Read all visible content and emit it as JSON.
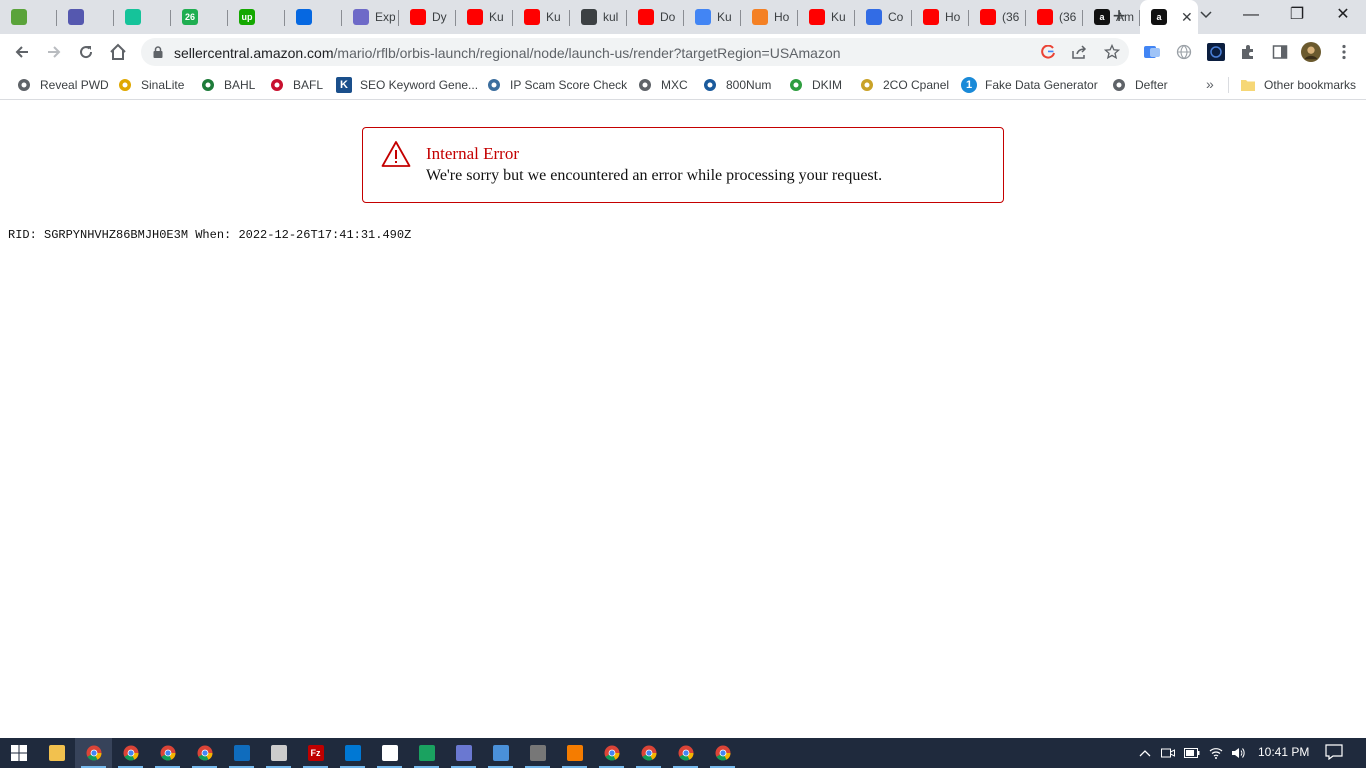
{
  "browser": {
    "tabs": [
      {
        "title": "",
        "icon": "script-icon",
        "color": "#5aa33a"
      },
      {
        "title": "",
        "icon": "teams-icon",
        "color": "#5558af"
      },
      {
        "title": "",
        "icon": "grammarly-icon",
        "color": "#15c39a"
      },
      {
        "title": "",
        "icon": "badge-26-icon",
        "color": "#1fae51",
        "badge": "26"
      },
      {
        "title": "",
        "icon": "upwork-icon",
        "color": "#14a800",
        "badge": "up"
      },
      {
        "title": "",
        "icon": "meta-icon",
        "color": "#0668e1"
      },
      {
        "title": "Exp",
        "icon": "explore-icon",
        "color": "#6e6ac8"
      },
      {
        "title": "Dy",
        "icon": "youtube-icon",
        "color": "#ff0000"
      },
      {
        "title": "Ku",
        "icon": "youtube-icon",
        "color": "#ff0000"
      },
      {
        "title": "Ku",
        "icon": "youtube-icon",
        "color": "#ff0000"
      },
      {
        "title": "kul",
        "icon": "kube-icon",
        "color": "#3c4043"
      },
      {
        "title": "Do",
        "icon": "youtube-icon",
        "color": "#ff0000"
      },
      {
        "title": "Ku",
        "icon": "google-cloud-icon",
        "color": "#4285f4"
      },
      {
        "title": "Ho",
        "icon": "stackoverflow-icon",
        "color": "#f48024"
      },
      {
        "title": "Ku",
        "icon": "youtube-icon",
        "color": "#ff0000"
      },
      {
        "title": "Co",
        "icon": "kubernetes-icon",
        "color": "#326ce5"
      },
      {
        "title": "Ho",
        "icon": "youtube-icon",
        "color": "#ff0000"
      },
      {
        "title": "(36",
        "icon": "youtube-icon",
        "color": "#ff0000"
      },
      {
        "title": "(36",
        "icon": "youtube-icon",
        "color": "#ff0000"
      },
      {
        "title": "Am",
        "icon": "amazon-icon",
        "color": "#111111",
        "badge": "a"
      }
    ],
    "active_tab": {
      "icon": "amazon-icon",
      "color": "#111111",
      "badge": "a",
      "close": "✕"
    },
    "new_tab": "+",
    "url_host": "sellercentral.amazon.com",
    "url_path": "/mario/rflb/orbis-launch/regional/node/launch-us/render?targetRegion=USAmazon",
    "window_controls": {
      "minimize": "—",
      "restore": "❐",
      "close": "✕"
    }
  },
  "bookmarks": [
    {
      "label": "Reveal PWD",
      "icon": "globe-icon",
      "color": "#5f6368"
    },
    {
      "label": "SinaLite",
      "icon": "dots-icon",
      "color": "#e0a800"
    },
    {
      "label": "BAHL",
      "icon": "bank-icon",
      "color": "#1e7b3a"
    },
    {
      "label": "BAFL",
      "icon": "alfalah-icon",
      "color": "#c8102e"
    },
    {
      "label": "SEO Keyword Gene...",
      "icon": "k-icon",
      "color": "#1a4f8b",
      "badge": "K"
    },
    {
      "label": "IP Scam Score Check",
      "icon": "shield-icon",
      "color": "#3c6e9e"
    },
    {
      "label": "MXC",
      "icon": "globe-icon",
      "color": "#5f6368"
    },
    {
      "label": "800Num",
      "icon": "grid-icon",
      "color": "#1a5a9c"
    },
    {
      "label": "DKIM",
      "icon": "wifi-icon",
      "color": "#2e9e3f"
    },
    {
      "label": "2CO Cpanel",
      "icon": "lock-icon",
      "color": "#c9a227"
    },
    {
      "label": "Fake Data Generator",
      "icon": "one-icon",
      "color": "#1a8ad8",
      "badge": "1"
    },
    {
      "label": "Defter",
      "icon": "globe-icon",
      "color": "#5f6368"
    }
  ],
  "bookmarks_more": "»",
  "other_bookmarks": "Other bookmarks",
  "error": {
    "title": "Internal Error",
    "message": "We're sorry but we encountered an error while processing your request."
  },
  "rid_line": "RID: SGRPYNHVHZ86BMJH0E3M When: 2022-12-26T17:41:31.490Z",
  "taskbar": {
    "apps": [
      {
        "icon": "windows-start-icon",
        "color": "#ffffff"
      },
      {
        "icon": "file-explorer-icon",
        "color": "#f2c14e"
      },
      {
        "icon": "chrome-icon",
        "color": "#4285f4",
        "active": true
      },
      {
        "icon": "chrome-icon",
        "color": "#4285f4"
      },
      {
        "icon": "chrome-icon",
        "color": "#4285f4"
      },
      {
        "icon": "chrome-icon",
        "color": "#4285f4"
      },
      {
        "icon": "mail-icon",
        "color": "#0f6cbd"
      },
      {
        "icon": "tools-icon",
        "color": "#cccccc"
      },
      {
        "icon": "filezilla-icon",
        "color": "#bf0000",
        "badge": "Fz"
      },
      {
        "icon": "vscode-icon",
        "color": "#0078d4"
      },
      {
        "icon": "circle-app-icon",
        "color": "#ffffff"
      },
      {
        "icon": "green-app-icon",
        "color": "#1aa260"
      },
      {
        "icon": "feather-icon",
        "color": "#6a78d1"
      },
      {
        "icon": "remote-desktop-icon",
        "color": "#4a90d9"
      },
      {
        "icon": "calculator-icon",
        "color": "#777777"
      },
      {
        "icon": "orange-app-icon",
        "color": "#f57c00"
      },
      {
        "icon": "chrome-icon",
        "color": "#4285f4"
      },
      {
        "icon": "chrome-icon",
        "color": "#4285f4"
      },
      {
        "icon": "chrome-icon",
        "color": "#4285f4"
      },
      {
        "icon": "chrome-icon",
        "color": "#4285f4"
      }
    ],
    "time": "10:41 PM"
  }
}
